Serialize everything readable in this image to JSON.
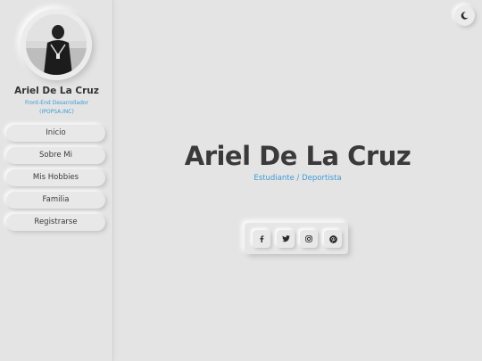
{
  "profile": {
    "name": "Ariel De La Cruz",
    "role": "Front-End Desarrollador (IPOPSA.INC)"
  },
  "nav": {
    "items": [
      "Inicio",
      "Sobre Mi",
      "Mis Hobbies",
      "Familia",
      "Registrarse"
    ]
  },
  "hero": {
    "title": "Ariel De La Cruz",
    "subtitle": "Estudiante / Deportista"
  },
  "social": {
    "icons": [
      "facebook-icon",
      "twitter-icon",
      "instagram-icon",
      "pinterest-icon"
    ]
  },
  "theme_toggle": {
    "icon": "moon-icon"
  },
  "colors": {
    "background": "#e4e4e4",
    "accent": "#3d9bd6",
    "text": "#3a3a3a"
  }
}
